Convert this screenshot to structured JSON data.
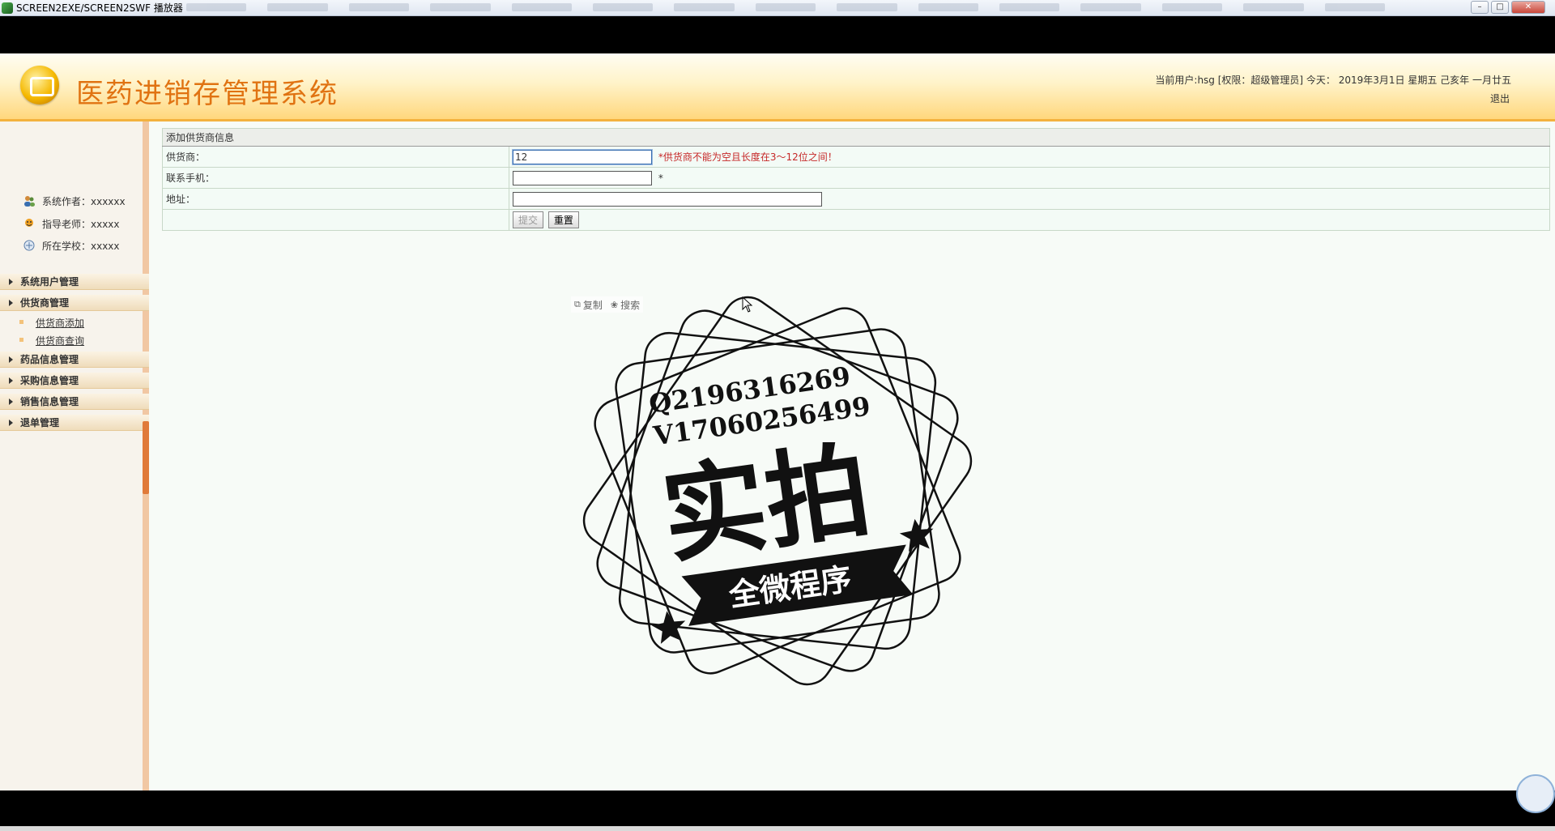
{
  "player": {
    "title": "SCREEN2EXE/SCREEN2SWF 播放器",
    "min_label": "–",
    "max_label": "□",
    "close_label": "✕"
  },
  "header": {
    "title": "医药进销存管理系统",
    "user_info": "当前用户:hsg [权限：超级管理员] 今天： 2019年3月1日 星期五 己亥年 一月廿五",
    "logout": "退出"
  },
  "sidebar": {
    "info": [
      {
        "label": "系统作者：xxxxxx",
        "icon": "users-icon"
      },
      {
        "label": "指导老师：xxxxx",
        "icon": "teacher-icon"
      },
      {
        "label": "所在学校：xxxxx",
        "icon": "school-icon"
      }
    ],
    "menu": [
      {
        "label": "系统用户管理"
      },
      {
        "label": "供货商管理",
        "children": [
          "供货商添加",
          "供货商查询"
        ]
      },
      {
        "label": "药品信息管理"
      },
      {
        "label": "采购信息管理"
      },
      {
        "label": "销售信息管理"
      },
      {
        "label": "退单管理"
      }
    ]
  },
  "form": {
    "caption": "添加供货商信息",
    "supplier_label": "供货商：",
    "supplier_value": "12",
    "supplier_error": "*供货商不能为空且长度在3～12位之间！",
    "phone_label": "联系手机：",
    "phone_value": "",
    "phone_required": "*",
    "address_label": "地址：",
    "address_value": "",
    "submit_label": "提交",
    "reset_label": "重置"
  },
  "float_tools": {
    "copy": "复制",
    "search": "搜索"
  },
  "watermark": {
    "line1": "Q2196316269",
    "line2": "V17060256499",
    "main": "实拍",
    "banner": "全微程序"
  }
}
